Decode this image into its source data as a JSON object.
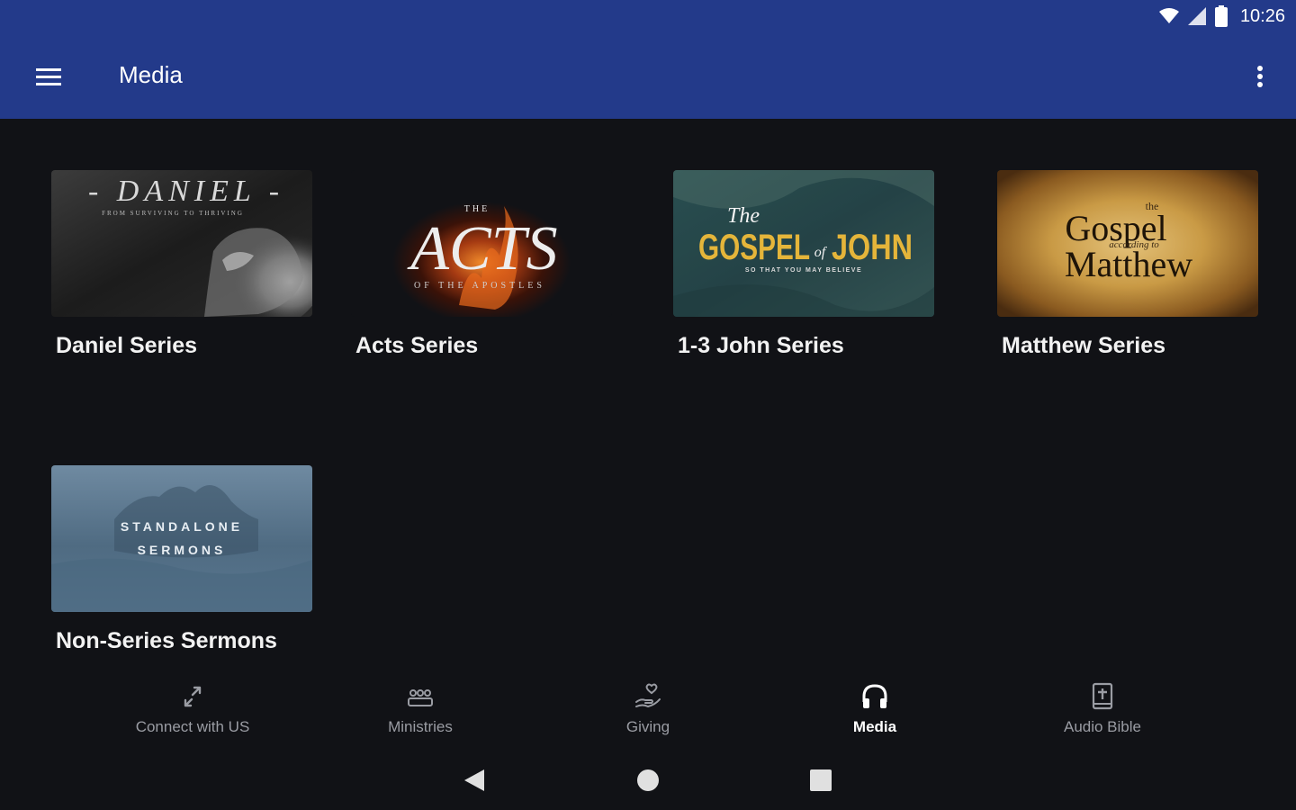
{
  "status_bar": {
    "time": "10:26",
    "icons": [
      "wifi-icon",
      "signal-icon",
      "battery-icon"
    ]
  },
  "app_bar": {
    "title": "Media",
    "menu_icon": "hamburger-menu-icon",
    "overflow_icon": "more-vert-icon",
    "color": "#233a8a"
  },
  "media": {
    "items": [
      {
        "title": "Daniel Series",
        "thumbnail": {
          "heading": "- DANIEL -",
          "subheading": "FROM SURVIVING TO THRIVING"
        }
      },
      {
        "title": "Acts Series",
        "thumbnail": {
          "kicker": "THE",
          "heading": "ACTS",
          "subheading": "OF THE APOSTLES"
        }
      },
      {
        "title": "1-3 John Series",
        "thumbnail": {
          "kicker": "The",
          "heading": "GOSPEL",
          "connector": "of",
          "heading2": "JOHN",
          "subheading": "SO THAT YOU MAY BELIEVE"
        }
      },
      {
        "title": "Matthew Series",
        "thumbnail": {
          "kicker": "the",
          "heading": "Gospel",
          "connector": "according to",
          "heading2": "Matthew"
        }
      },
      {
        "title": "Non-Series Sermons",
        "thumbnail": {
          "heading": "STANDALONE",
          "heading2": "SERMONS"
        }
      }
    ]
  },
  "bottom_nav": {
    "items": [
      {
        "label": "Connect with US",
        "icon": "connect-arrows-icon",
        "active": false
      },
      {
        "label": "Ministries",
        "icon": "group-people-icon",
        "active": false
      },
      {
        "label": "Giving",
        "icon": "hand-heart-icon",
        "active": false
      },
      {
        "label": "Media",
        "icon": "headphones-icon",
        "active": true
      },
      {
        "label": "Audio Bible",
        "icon": "bible-book-icon",
        "active": false
      }
    ]
  },
  "system_nav": {
    "buttons": [
      "back-icon",
      "home-icon",
      "recents-icon"
    ]
  }
}
